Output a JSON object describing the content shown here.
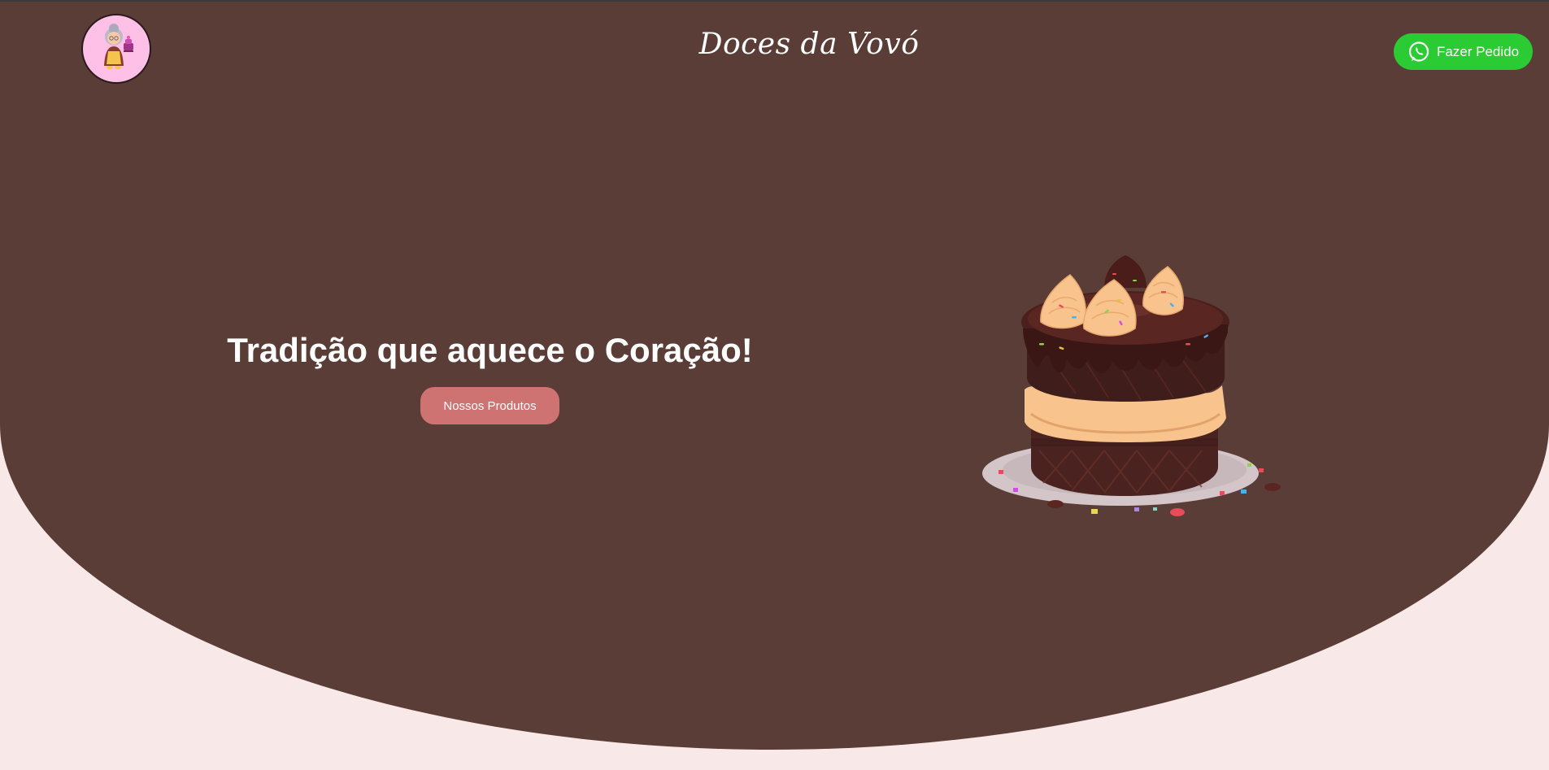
{
  "header": {
    "brand_title": "Doces da Vovó",
    "order_button_label": "Fazer Pedido",
    "order_button_icon": "whatsapp-icon",
    "logo_icon": "grandma-baker-logo"
  },
  "hero": {
    "title": "Tradição que aquece o Coração!",
    "products_button_label": "Nossos Produtos",
    "image_icon": "chocolate-cake-illustration"
  },
  "colors": {
    "hero_background": "#5a3d36",
    "page_background": "#f8e8e7",
    "order_button": "#2bcb34",
    "products_button": "#cf7272",
    "logo_background": "#ffc0e8"
  }
}
